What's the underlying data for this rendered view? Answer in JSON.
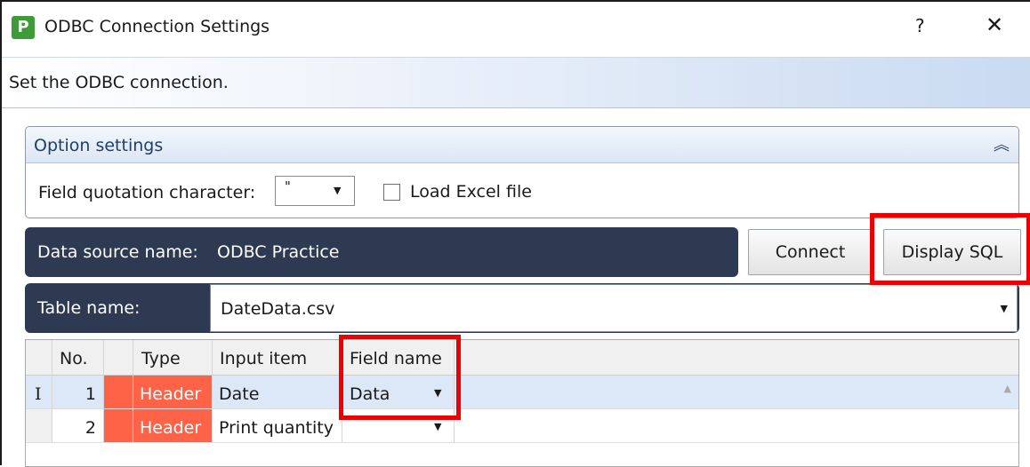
{
  "window": {
    "app_icon": "P",
    "title": "ODBC Connection Settings",
    "help": "?",
    "close": "✕"
  },
  "banner": {
    "text": "Set the ODBC connection."
  },
  "options": {
    "title": "Option settings",
    "collapse_icon": "chevron-double-up-icon",
    "quote_label": "Field quotation character:",
    "quote_value": "\"",
    "load_excel_label": "Load Excel file",
    "load_excel_checked": false
  },
  "datasource": {
    "label": "Data source name:",
    "value": "ODBC Practice",
    "connect_label": "Connect",
    "display_sql_label": "Display SQL"
  },
  "table": {
    "label": "Table name:",
    "value": "DateData.csv"
  },
  "grid": {
    "columns": [
      "No.",
      "",
      "Type",
      "Input item",
      "Field name"
    ],
    "rows": [
      {
        "indicator": "I",
        "no": "1",
        "type": "Header",
        "input_item": "Date",
        "field_name": "Data"
      },
      {
        "indicator": "",
        "no": "2",
        "type": "Header",
        "input_item": "Print quantity",
        "field_name": ""
      }
    ]
  },
  "colors": {
    "accent_dark": "#2d3a52",
    "highlight_red": "#ee0000",
    "type_cell": "#ff6347",
    "selected_row": "#dce8f7"
  }
}
